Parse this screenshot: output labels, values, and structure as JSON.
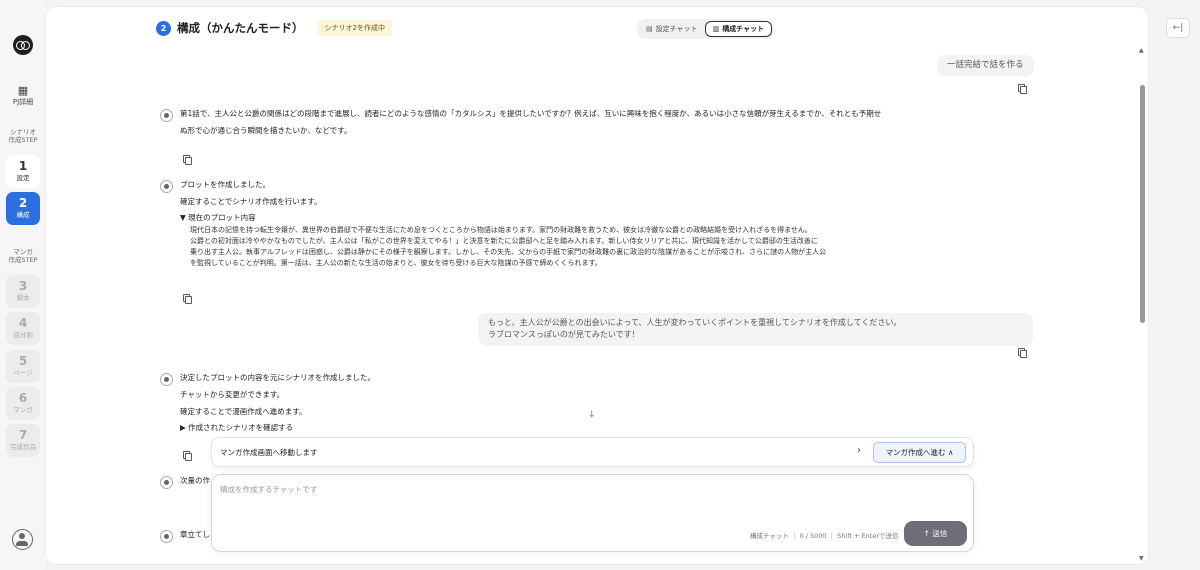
{
  "sidebar": {
    "pj_label": "PJ詳細",
    "pj_icon": "grid-icon",
    "scenario_group": [
      "シナリオ",
      "作成STEP"
    ],
    "manga_group": [
      "マンガ",
      "作成STEP"
    ],
    "steps": [
      {
        "num": "1",
        "label": "設定",
        "state": "normal"
      },
      {
        "num": "2",
        "label": "構成",
        "state": "active"
      },
      {
        "num": "3",
        "label": "脚本",
        "state": "disabled"
      },
      {
        "num": "4",
        "label": "話分割",
        "state": "disabled"
      },
      {
        "num": "5",
        "label": "ページ",
        "state": "disabled"
      },
      {
        "num": "6",
        "label": "マンガ",
        "state": "disabled"
      },
      {
        "num": "7",
        "label": "完成作品",
        "state": "disabled"
      }
    ]
  },
  "header": {
    "step_num": "2",
    "title": "構成（かんたんモード）",
    "status": "シナリオ2を作成中"
  },
  "tabs": [
    {
      "label": "設定チャット",
      "icon": "document-icon",
      "active": false
    },
    {
      "label": "構成チャット",
      "icon": "book-icon",
      "active": true
    }
  ],
  "collapse_icon": "←|",
  "messages": {
    "user1": "一話完結で話を作る",
    "ai1": [
      "第1話で、主人公と公爵の関係はどの段階まで進展し、読者にどのような感情の「カタルシス」を提供したいですか？例えば、互いに興味を抱く程度か、あるいは小さな信頼が芽生えるまでか、それとも予期せ",
      "ぬ形で心が通じ合う瞬間を描きたいか、などです。"
    ],
    "ai2": {
      "line1": "プロットを作成しました。",
      "line2": "確定することでシナリオ作成を行います。",
      "section": "▼ 現在のプロット内容",
      "body": [
        "現代日本の記憶を持つ転生令嬢が、異世界の伯爵邸で不便な生活にため息をつくところから物語は始まります。家門の財政難を救うため、彼女は冷徹な公爵との政略結婚を受け入れざるを得ません。",
        "公爵との初対面は冷ややかなものでしたが、主人公は「私がこの世界を変えてやる！」と決意を新たに公爵邸へと足を踏み入れます。新しい侍女リリアと共に、現代知識を活かして公爵邸の生活改善に",
        "乗り出す主人公。執事アルフレッドは困惑し、公爵は静かにその様子を観察します。しかし、その矢先、父からの手紙で家門の財政難の裏に政治的な陰謀があることが示唆され、さらに謎の人物が主人公",
        "を監視していることが判明。第一話は、主人公の新たな生活の始まりと、彼女を待ち受ける巨大な陰謀の予感で締めくくられます。"
      ]
    },
    "user2": [
      "もっと、主人公が公爵との出会いによって、人生が変わっていくポイントを重視してシナリオを作成してください。",
      "ラブロマンスっぽいのが見てみたいです！"
    ],
    "ai3": {
      "lines": [
        "決定したプロットの内容を元にシナリオを作成しました。",
        "チャットから変更ができます。",
        "確定することで漫画作成へ進めます。"
      ],
      "section": "▶ 作成されたシナリオを確認する"
    },
    "ai4_partial": "次量の作",
    "ai5_partial": "章立てし"
  },
  "banner": {
    "text": "マンガ作成画面へ移動します",
    "chevron": "›",
    "button": "マンガ作成へ進む ∧"
  },
  "chat_input": {
    "placeholder": "構成を作成するチャットです",
    "meta": "構成チャット ｜ 0 / 5000 ｜ Shift + Enterで送信",
    "send": "↑  送信"
  }
}
